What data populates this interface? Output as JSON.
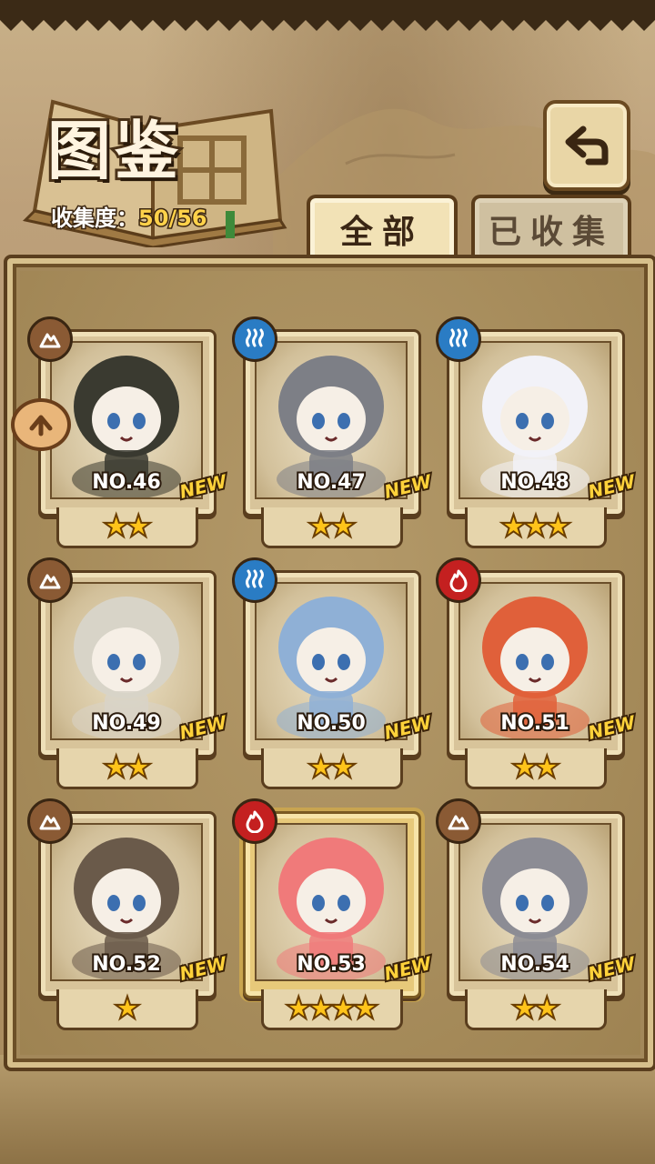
{
  "header": {
    "title": "图鉴",
    "collect_label": "收集度：",
    "collect_value": "50/56",
    "back_icon": "back-arrow-icon"
  },
  "tabs": [
    {
      "label": "全部",
      "selected": true
    },
    {
      "label": "已收集",
      "selected": false
    }
  ],
  "new_badge": "NEW",
  "cards": [
    {
      "no": "NO.46",
      "element": "earth",
      "stars": 2,
      "new": true
    },
    {
      "no": "NO.47",
      "element": "water",
      "stars": 2,
      "new": true
    },
    {
      "no": "NO.48",
      "element": "water",
      "stars": 3,
      "new": true
    },
    {
      "no": "NO.49",
      "element": "earth",
      "stars": 2,
      "new": true
    },
    {
      "no": "NO.50",
      "element": "water",
      "stars": 2,
      "new": true
    },
    {
      "no": "NO.51",
      "element": "fire",
      "stars": 2,
      "new": true
    },
    {
      "no": "NO.52",
      "element": "earth",
      "stars": 1,
      "new": true
    },
    {
      "no": "NO.53",
      "element": "fire",
      "stars": 4,
      "new": true
    },
    {
      "no": "NO.54",
      "element": "earth",
      "stars": 2,
      "new": true
    }
  ],
  "colors": {
    "earth": "#8a5a34",
    "water": "#2a7cc4",
    "fire": "#c42020",
    "star": "#ffc41a",
    "new_text": "#ffd23a"
  }
}
